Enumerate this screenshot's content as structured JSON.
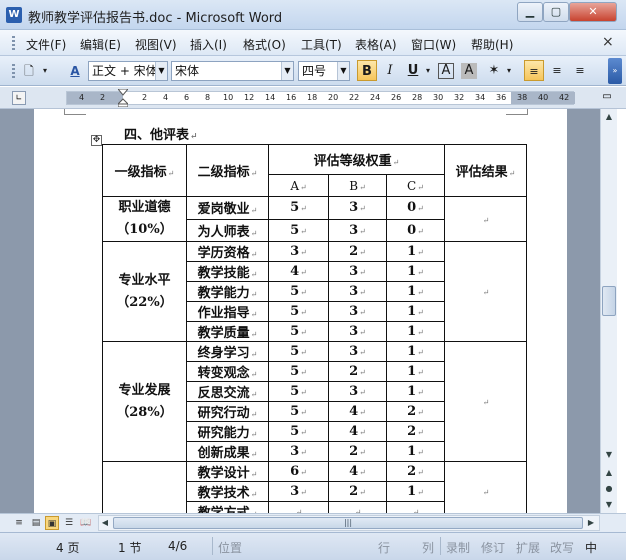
{
  "window": {
    "app_icon": "W",
    "title": "教师教学评估报告书.doc - Microsoft Word",
    "min_glyph": "▁",
    "max_glyph": "▢",
    "close_glyph": "✕"
  },
  "menu": {
    "items": [
      "文件(F)",
      "编辑(E)",
      "视图(V)",
      "插入(I)",
      "格式(O)",
      "工具(T)",
      "表格(A)",
      "窗口(W)",
      "帮助(H)"
    ],
    "close_glyph": "×"
  },
  "toolbar": {
    "style_combo": "正文 + 宋体",
    "font_combo": "宋体",
    "size_combo": "四号",
    "bold": "B",
    "italic": "I",
    "underline": "U",
    "char_border": "A",
    "char_shading": "A",
    "new_doc_glyph": "🗋",
    "styles_glyph": "A",
    "overflow_glyph": "»"
  },
  "ruler": {
    "numbers": [
      "4",
      "2",
      "2",
      "4",
      "6",
      "8",
      "10",
      "12",
      "14",
      "16",
      "18",
      "20",
      "22",
      "24",
      "26",
      "28",
      "30",
      "32",
      "34",
      "36",
      "38",
      "40",
      "42"
    ]
  },
  "document": {
    "heading": "四、他评表",
    "table": {
      "header_col1": "一级指标",
      "header_col2": "二级指标",
      "header_weights": "评估等级权重",
      "header_a": "A",
      "header_b": "B",
      "header_c": "C",
      "header_result": "评估结果",
      "groups": [
        {
          "name": "职业道德",
          "weight": "（10%）",
          "rows": [
            {
              "item": "爱岗敬业",
              "a": "5",
              "b": "3",
              "c": "0"
            },
            {
              "item": "为人师表",
              "a": "5",
              "b": "3",
              "c": "0"
            }
          ]
        },
        {
          "name": "专业水平",
          "weight": "（22%）",
          "rows": [
            {
              "item": "学历资格",
              "a": "3",
              "b": "2",
              "c": "1"
            },
            {
              "item": "教学技能",
              "a": "4",
              "b": "3",
              "c": "1"
            },
            {
              "item": "教学能力",
              "a": "5",
              "b": "3",
              "c": "1"
            },
            {
              "item": "作业指导",
              "a": "5",
              "b": "3",
              "c": "1"
            },
            {
              "item": "教学质量",
              "a": "5",
              "b": "3",
              "c": "1"
            }
          ]
        },
        {
          "name": "专业发展",
          "weight": "（28%）",
          "rows": [
            {
              "item": "终身学习",
              "a": "5",
              "b": "3",
              "c": "1"
            },
            {
              "item": "转变观念",
              "a": "5",
              "b": "2",
              "c": "1"
            },
            {
              "item": "反思交流",
              "a": "5",
              "b": "3",
              "c": "1"
            },
            {
              "item": "研究行动",
              "a": "5",
              "b": "4",
              "c": "2"
            },
            {
              "item": "研究能力",
              "a": "5",
              "b": "4",
              "c": "2"
            },
            {
              "item": "创新成果",
              "a": "3",
              "b": "2",
              "c": "1"
            }
          ]
        },
        {
          "name": "",
          "weight": "",
          "rows": [
            {
              "item": "教学设计",
              "a": "6",
              "b": "4",
              "c": "2"
            },
            {
              "item": "教学技术",
              "a": "3",
              "b": "2",
              "c": "1"
            },
            {
              "item": "教学方式",
              "a": "",
              "b": "",
              "c": ""
            }
          ]
        }
      ]
    }
  },
  "status": {
    "page": "4 页",
    "section": "1 节",
    "page_of": "4/6",
    "position": "位置",
    "line": "行",
    "column": "列",
    "rec": "录制",
    "trk": "修订",
    "ext": "扩展",
    "ovr": "改写",
    "lang": "中"
  },
  "colors": {
    "doc_background": "#8c99ab",
    "bold_active": "#f6c55b"
  }
}
